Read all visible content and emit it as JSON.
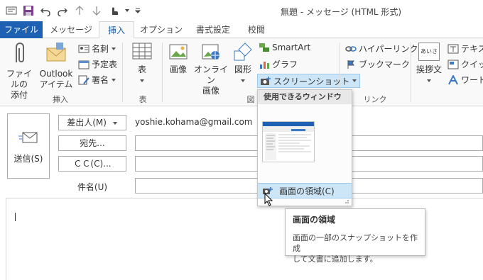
{
  "window": {
    "title": "無題 - メッセージ (HTML 形式)"
  },
  "tabs": [
    {
      "label": "ファイル"
    },
    {
      "label": "メッセージ"
    },
    {
      "label": "挿入"
    },
    {
      "label": "オプション"
    },
    {
      "label": "書式設定"
    },
    {
      "label": "校閲"
    }
  ],
  "ribbon": {
    "groups": {
      "insert": "挿入",
      "table": "表",
      "illustration": "図",
      "link": "リンク"
    },
    "attach_file": {
      "line1": "ファイルの",
      "line2": "添付"
    },
    "outlook_item": {
      "line1": "Outlook",
      "line2": "アイテム"
    },
    "business_card": "名刺",
    "calendar": "予定表",
    "signature": "署名",
    "table": "表",
    "picture": "画像",
    "online_picture": {
      "line1": "オンライン",
      "line2": "画像"
    },
    "shapes": "図形",
    "smartart": "SmartArt",
    "chart": "グラフ",
    "screenshot": "スクリーンショット",
    "hyperlink": "ハイパーリンク",
    "bookmark": "ブックマーク",
    "greeting": "挨拶文",
    "greeting_icon_text": "あいさつ",
    "textbox": "テキスト",
    "quickparts": "クイック",
    "wordart": "ワードア"
  },
  "compose": {
    "send": "送信(S)",
    "from": "差出人(M)",
    "from_value": "yoshie.kohama@gmail.com",
    "to": "宛先...",
    "cc": "ＣＣ(C)...",
    "subject": "件名(U)"
  },
  "dropdown": {
    "header": "使用できるウィンドウ",
    "screen_clipping": "画面の領域(C)"
  },
  "tooltip": {
    "title": "画面の領域",
    "line1": "画面の一部のスナップショットを作成",
    "line2": "して文書に追加します。"
  },
  "colors": {
    "accent": "#1e61b3",
    "file_tab": "#1e61b3"
  }
}
